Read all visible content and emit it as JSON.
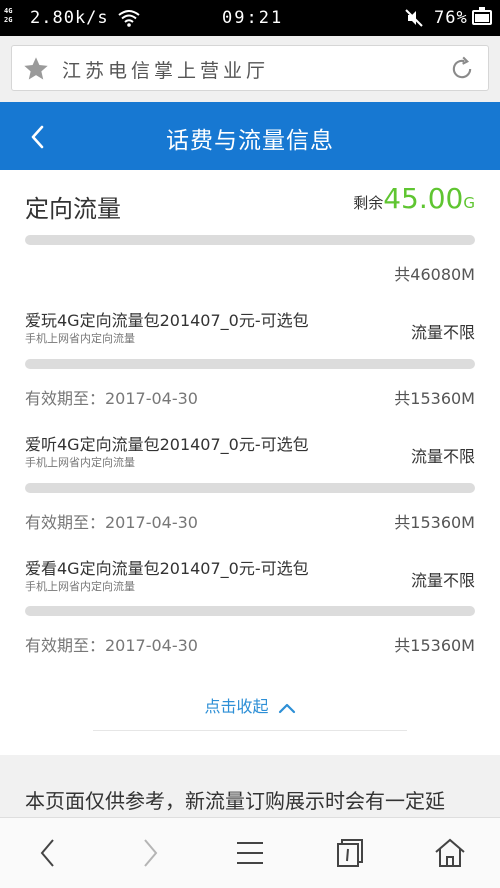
{
  "status_bar": {
    "network_top": "4G",
    "network_bottom": "2G",
    "speed": "2.80k/s",
    "time": "09:21",
    "battery_text": "76%",
    "battery_level": 0.76,
    "icons": [
      "wifi-icon",
      "mute-icon",
      "battery-icon"
    ]
  },
  "url_bar": {
    "title": "江苏电信掌上营业厅",
    "icons": [
      "star-icon",
      "refresh-icon"
    ]
  },
  "header": {
    "title": "话费与流量信息",
    "back_icon": "chevron-left-icon",
    "color": "#1778d2"
  },
  "section": {
    "title": "定向流量",
    "remain_label": "剩余",
    "remain_value": "45.00",
    "remain_unit": "G",
    "remain_color": "#5fc531",
    "total": "共46080M"
  },
  "packages": [
    {
      "name": "爱玩4G定向流量包201407_0元-可选包",
      "sub": "手机上网省内定向流量",
      "status": "流量不限",
      "expiry": "有效期至：2017-04-30",
      "total": "共15360M"
    },
    {
      "name": "爱听4G定向流量包201407_0元-可选包",
      "sub": "手机上网省内定向流量",
      "status": "流量不限",
      "expiry": "有效期至：2017-04-30",
      "total": "共15360M"
    },
    {
      "name": "爱看4G定向流量包201407_0元-可选包",
      "sub": "手机上网省内定向流量",
      "status": "流量不限",
      "expiry": "有效期至：2017-04-30",
      "total": "共15360M"
    }
  ],
  "collapse": {
    "label": "点击收起",
    "icon": "chevron-up-icon"
  },
  "notice": {
    "text": "本页面仅供参考，新流量订购展示时会有一定延"
  },
  "bottom_nav": {
    "icons": [
      "back-icon",
      "forward-icon",
      "menu-icon",
      "tabs-icon",
      "home-icon"
    ]
  }
}
